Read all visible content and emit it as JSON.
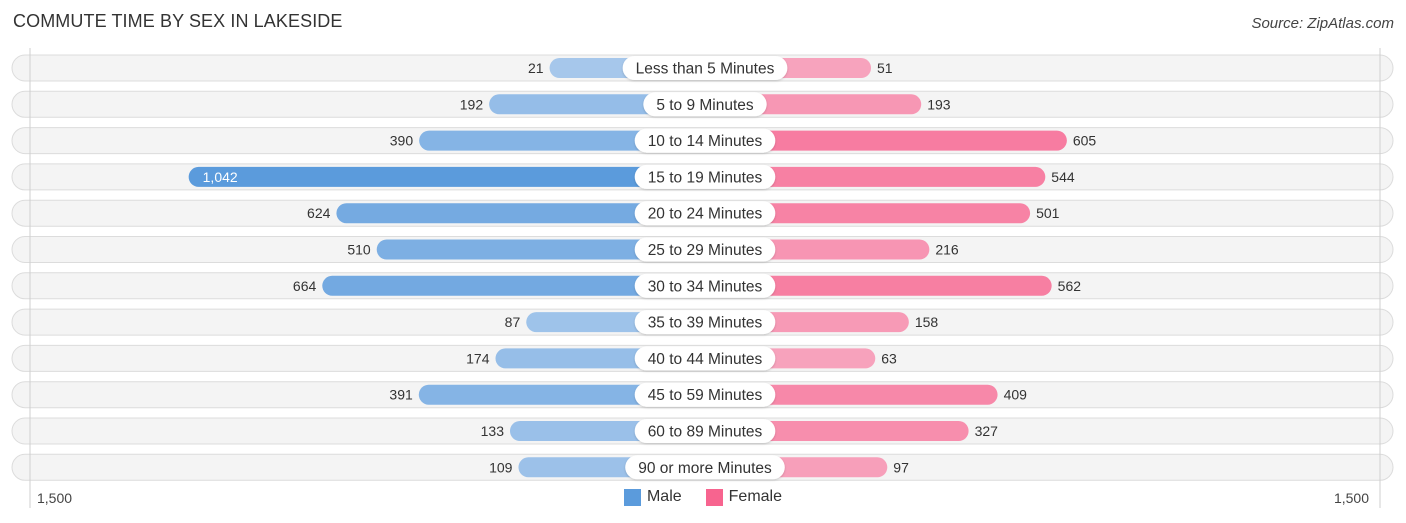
{
  "title": "COMMUTE TIME BY SEX IN LAKESIDE",
  "source": "Source: ZipAtlas.com",
  "colors": {
    "male": "#5b9bdc",
    "male_light": "#a9c9ec",
    "female": "#f7648f",
    "female_light": "#f7a9c1",
    "track": "#f4f4f4",
    "track_border": "#dcdcdc"
  },
  "chart_data": {
    "type": "bar",
    "orientation": "horizontal-diverging",
    "title": "COMMUTE TIME BY SEX IN LAKESIDE",
    "categories": [
      "Less than 5 Minutes",
      "5 to 9 Minutes",
      "10 to 14 Minutes",
      "15 to 19 Minutes",
      "20 to 24 Minutes",
      "25 to 29 Minutes",
      "30 to 34 Minutes",
      "35 to 39 Minutes",
      "40 to 44 Minutes",
      "45 to 59 Minutes",
      "60 to 89 Minutes",
      "90 or more Minutes"
    ],
    "series": [
      {
        "name": "Male",
        "values": [
          21,
          192,
          390,
          1042,
          624,
          510,
          664,
          87,
          174,
          391,
          133,
          109
        ],
        "labels": [
          "21",
          "192",
          "390",
          "1,042",
          "624",
          "510",
          "664",
          "87",
          "174",
          "391",
          "133",
          "109"
        ]
      },
      {
        "name": "Female",
        "values": [
          51,
          193,
          605,
          544,
          501,
          216,
          562,
          158,
          63,
          409,
          327,
          97
        ],
        "labels": [
          "51",
          "193",
          "605",
          "544",
          "501",
          "216",
          "562",
          "158",
          "63",
          "409",
          "327",
          "97"
        ]
      }
    ],
    "xlim": [
      -1500,
      1500
    ],
    "axis_tick_labels": {
      "left": "1,500",
      "right": "1,500"
    },
    "legend": {
      "position": "bottom-center",
      "entries": [
        "Male",
        "Female"
      ]
    },
    "grid": false
  }
}
